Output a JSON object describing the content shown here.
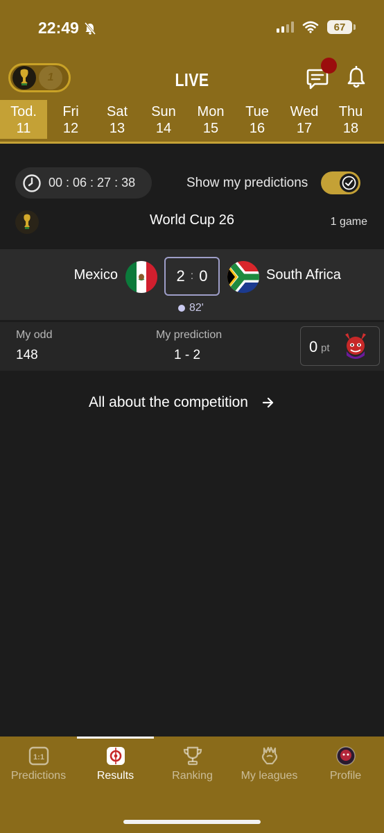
{
  "status_bar": {
    "time": "22:49",
    "battery": "67"
  },
  "header": {
    "title": "LIVE"
  },
  "days": [
    {
      "name": "Tod.",
      "num": "11",
      "active": true
    },
    {
      "name": "Fri",
      "num": "12"
    },
    {
      "name": "Sat",
      "num": "13"
    },
    {
      "name": "Sun",
      "num": "14"
    },
    {
      "name": "Mon",
      "num": "15"
    },
    {
      "name": "Tue",
      "num": "16"
    },
    {
      "name": "Wed",
      "num": "17"
    },
    {
      "name": "Thu",
      "num": "18"
    }
  ],
  "timer": "00 : 06 : 27 : 38",
  "show_predictions": {
    "label": "Show my predictions",
    "enabled": true
  },
  "competition": {
    "name": "World Cup 26",
    "games": "1 game"
  },
  "match": {
    "home": "Mexico",
    "away": "South Africa",
    "home_score": "2",
    "away_score": "0",
    "separator": ":",
    "minute": "82'"
  },
  "prediction": {
    "odd_label": "My odd",
    "odd_value": "148",
    "pred_label": "My prediction",
    "pred_value": "1 - 2",
    "points": "0",
    "points_unit": "pt"
  },
  "competition_link": "All about the competition",
  "nav": [
    {
      "label": "Predictions",
      "icon": "predictions-icon"
    },
    {
      "label": "Results",
      "icon": "results-icon",
      "active": true
    },
    {
      "label": "Ranking",
      "icon": "trophy-icon"
    },
    {
      "label": "My leagues",
      "icon": "leagues-icon"
    },
    {
      "label": "Profile",
      "icon": "profile-avatar"
    }
  ],
  "colors": {
    "gold": "#8a6b1a",
    "gold_light": "#c4a136",
    "background": "#1c1c1c",
    "notif": "#9b0d0d"
  }
}
